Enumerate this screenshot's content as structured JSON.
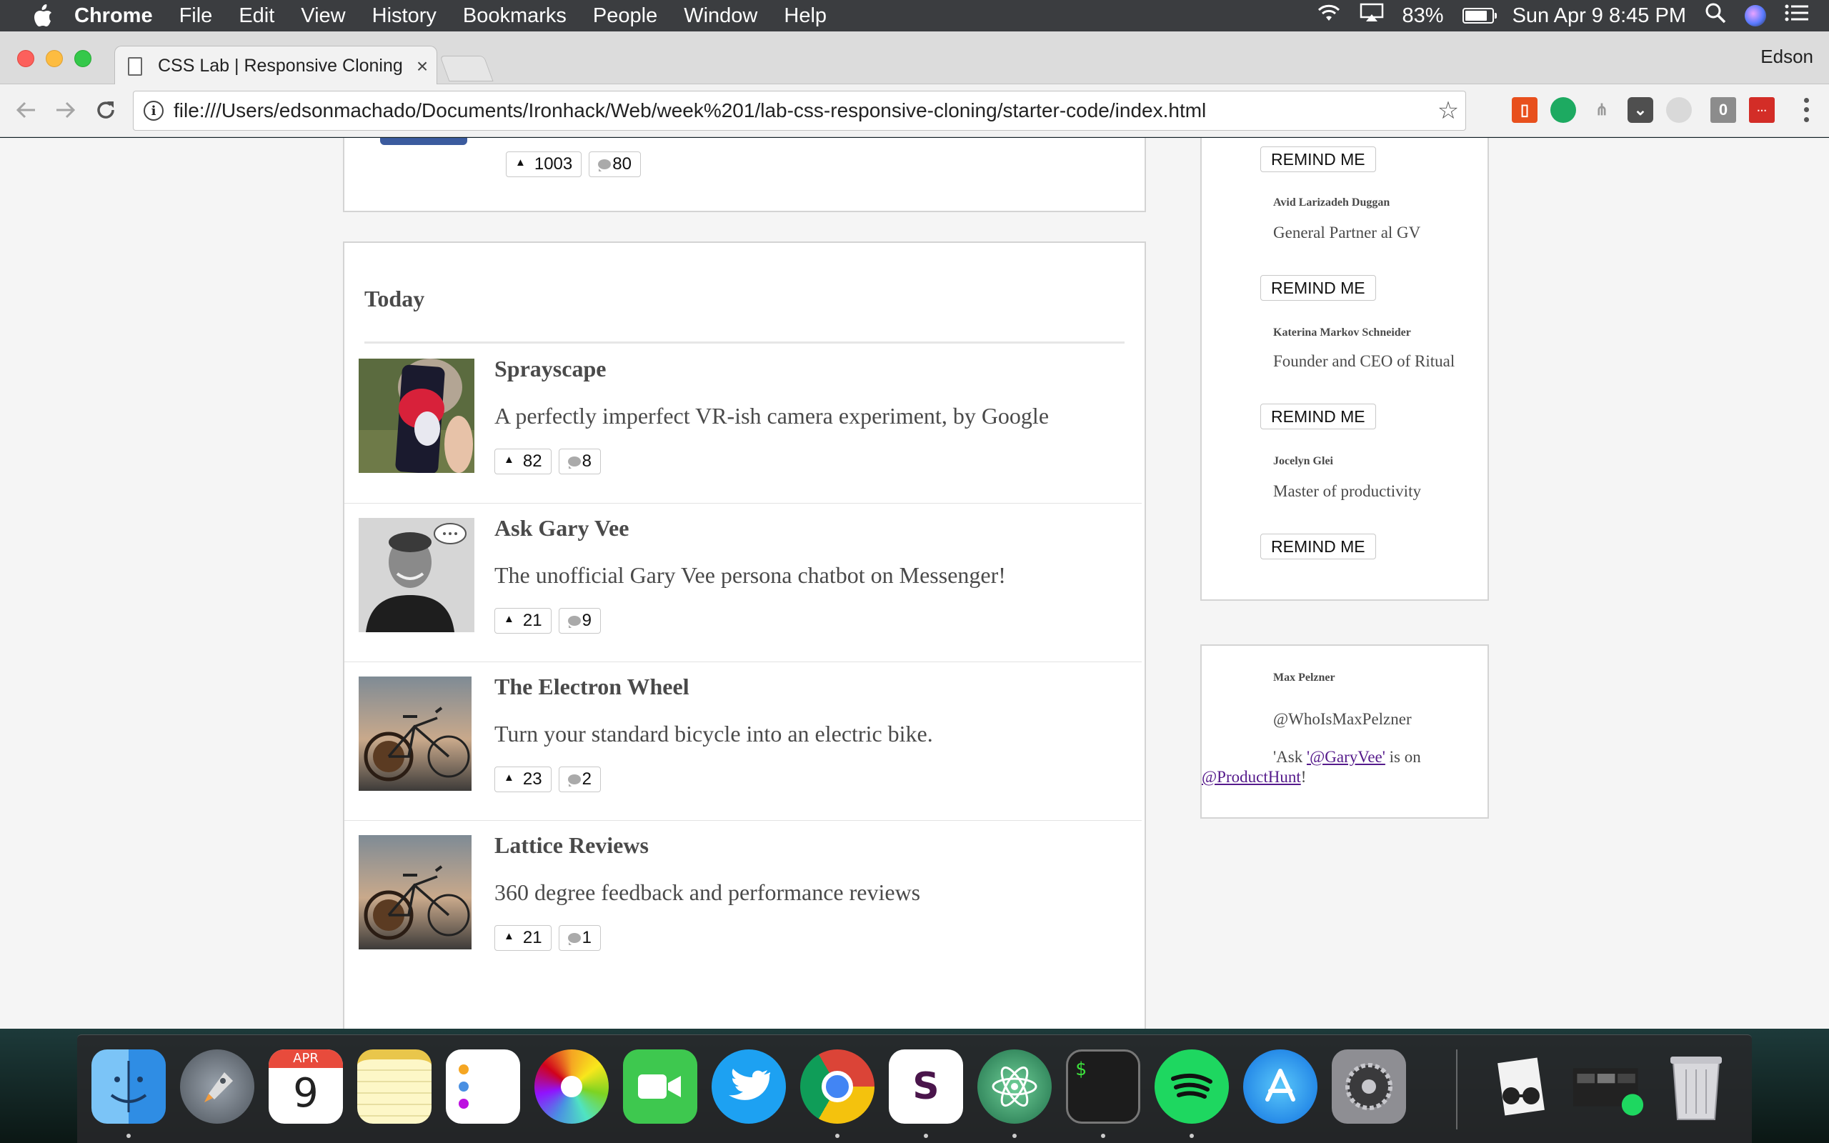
{
  "menubar": {
    "app": "Chrome",
    "items": [
      "File",
      "Edit",
      "View",
      "History",
      "Bookmarks",
      "People",
      "Window",
      "Help"
    ],
    "battery_percent": "83%",
    "battery_level": 0.83,
    "datetime": "Sun Apr 9  8:45 PM"
  },
  "browser": {
    "tab_title": "CSS Lab | Responsive Cloning",
    "tab_close": "×",
    "profile": "Edson",
    "url": "file:///Users/edsonmachado/Documents/Ironhack/Web/week%201/lab-css-responsive-cloning/starter-code/index.html",
    "extensions": [
      "office-icon",
      "hangouts-icon",
      "sitemap-icon",
      "pocket-icon",
      "ghostery-icon",
      "zero-icon",
      "lastpass-icon"
    ]
  },
  "page": {
    "prev_post": {
      "upvotes": "1003",
      "comments": "80"
    },
    "section_heading": "Today",
    "posts": [
      {
        "title": "Sprayscape",
        "tagline": "A perfectly imperfect VR-ish camera experiment, by Google",
        "upvotes": "82",
        "comments": "8"
      },
      {
        "title": "Ask Gary Vee",
        "tagline": "The unofficial Gary Vee persona chatbot on Messenger!",
        "upvotes": "21",
        "comments": "9"
      },
      {
        "title": "The Electron Wheel",
        "tagline": "Turn your standard bicycle into an electric bike.",
        "upvotes": "23",
        "comments": "2"
      },
      {
        "title": "Lattice Reviews",
        "tagline": "360 degree feedback and performance reviews",
        "upvotes": "21",
        "comments": "1"
      }
    ],
    "sidebar": {
      "remind_label": "REMIND ME",
      "speakers": [
        {
          "name": "Avid Larizadeh Duggan",
          "role": "General Partner al GV"
        },
        {
          "name": "Katerina Markov Schneider",
          "role": "Founder and CEO of Ritual"
        },
        {
          "name": "Jocelyn Glei",
          "role": "Master of productivity"
        }
      ],
      "tweet": {
        "name": "Max Pelzner",
        "handle": "@WhoIsMaxPelzner",
        "text_prefix": "'Ask ",
        "mention1": "'@GaryVee'",
        "text_middle": " is on",
        "mention2": "@ProductHunt",
        "text_suffix": "!"
      }
    }
  },
  "dock": {
    "apps": [
      "Finder",
      "Launchpad",
      "Calendar",
      "Notes",
      "Reminders",
      "Photos",
      "FaceTime",
      "Twitter",
      "Chrome",
      "Slack",
      "Atom",
      "Terminal",
      "Spotify",
      "App Store",
      "System Preferences",
      "Preview",
      "Screenshot Stack",
      "Trash"
    ],
    "calendar_month": "APR",
    "calendar_day": "9",
    "slack_letter": "S",
    "terminal_prompt": "$"
  }
}
